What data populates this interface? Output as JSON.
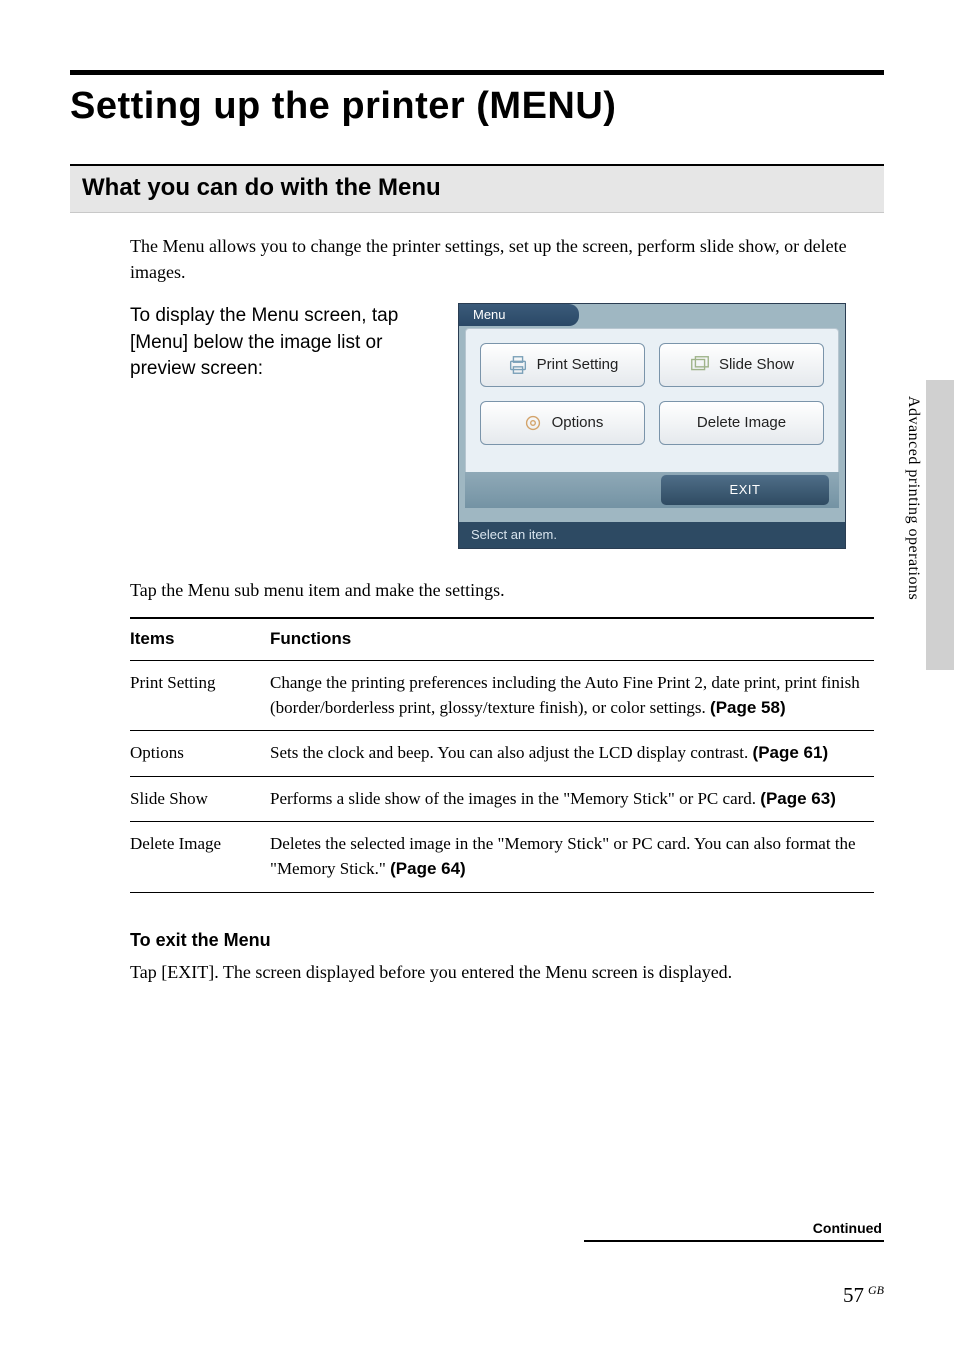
{
  "side_label": "Advanced printing operations",
  "heading1": "Setting up the printer (MENU)",
  "heading2": "What you can do with the Menu",
  "intro": "The Menu allows you to change the printer settings, set up the screen, perform slide show, or delete images.",
  "instruction": "To display the Menu screen, tap [Menu] below the image list or preview screen:",
  "menu_screenshot": {
    "tab": "Menu",
    "buttons": {
      "print_setting": "Print Setting",
      "slide_show": "Slide Show",
      "options": "Options",
      "delete_image": "Delete Image"
    },
    "exit": "EXIT",
    "status": "Select an item."
  },
  "sub_line": "Tap the Menu sub menu item and make the settings.",
  "table": {
    "headers": {
      "items": "Items",
      "functions": "Functions"
    },
    "rows": [
      {
        "item": "Print Setting",
        "func": "Change the printing preferences including the Auto Fine Print 2, date print, print finish (border/borderless print, glossy/texture finish), or color settings.  ",
        "pageref": "(Page 58)"
      },
      {
        "item": "Options",
        "func": "Sets the clock and beep.  You can also adjust the LCD display contrast. ",
        "pageref": "(Page 61)"
      },
      {
        "item": "Slide Show",
        "func": "Performs a slide show of the images in the \"Memory Stick\" or PC card. ",
        "pageref": "(Page 63)"
      },
      {
        "item": "Delete Image",
        "func": "Deletes the selected image in the \"Memory Stick\" or PC card. You can also format the \"Memory Stick.\" ",
        "pageref": "(Page 64)"
      }
    ]
  },
  "exit_section": {
    "heading": "To exit the Menu",
    "body": "Tap [EXIT].  The screen displayed before you entered the Menu screen is displayed."
  },
  "continued": "Continued",
  "page_number": "57",
  "page_suffix": "GB"
}
